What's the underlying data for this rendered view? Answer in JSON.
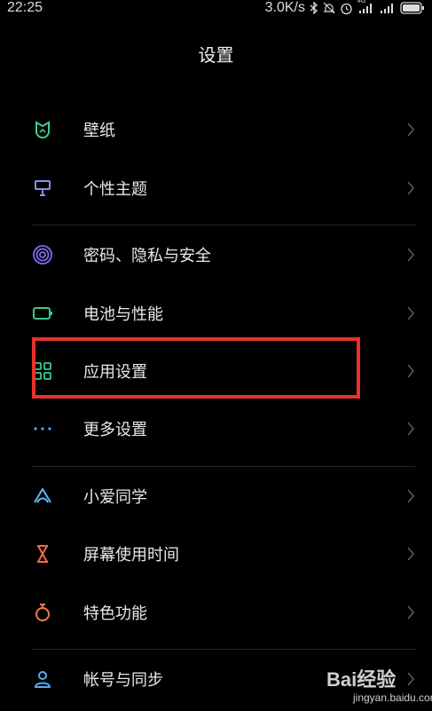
{
  "status_bar": {
    "time": "22:25",
    "network_speed": "3.0K/s",
    "icons": [
      "bluetooth-icon",
      "mute-icon",
      "alarm-icon",
      "signal-4g-icon",
      "signal-icon",
      "battery-icon"
    ],
    "signal_tag": "4G"
  },
  "header": {
    "title": "设置"
  },
  "settings_items": [
    {
      "id": "wallpaper",
      "label": "壁纸",
      "icon": "wallpaper-icon",
      "color": "#3fcf8e"
    },
    {
      "id": "themes",
      "label": "个性主题",
      "icon": "theme-brush-icon",
      "color": "#8e8cf0"
    },
    {
      "id": "privacy",
      "label": "密码、隐私与安全",
      "icon": "fingerprint-icon",
      "color": "#7c6cf0"
    },
    {
      "id": "battery",
      "label": "电池与性能",
      "icon": "battery-outline-icon",
      "color": "#3ac98a"
    },
    {
      "id": "apps",
      "label": "应用设置",
      "icon": "apps-grid-icon",
      "color": "#3ac98a",
      "highlighted": true
    },
    {
      "id": "more",
      "label": "更多设置",
      "icon": "more-dots-icon",
      "color": "#5aa8f0"
    },
    {
      "id": "xiaoai",
      "label": "小爱同学",
      "icon": "xiaoai-icon",
      "color": "#5ab8f0"
    },
    {
      "id": "screen_time",
      "label": "屏幕使用时间",
      "icon": "hourglass-icon",
      "color": "#f06a4a"
    },
    {
      "id": "features",
      "label": "特色功能",
      "icon": "special-feature-icon",
      "color": "#f07a4a"
    },
    {
      "id": "account",
      "label": "帐号与同步",
      "icon": "account-icon",
      "color": "#5aa8f0"
    }
  ],
  "annotation": {
    "color": "#e8312a"
  },
  "watermark": {
    "main": "Bai经验",
    "sub": "jingyan.baidu.com"
  }
}
